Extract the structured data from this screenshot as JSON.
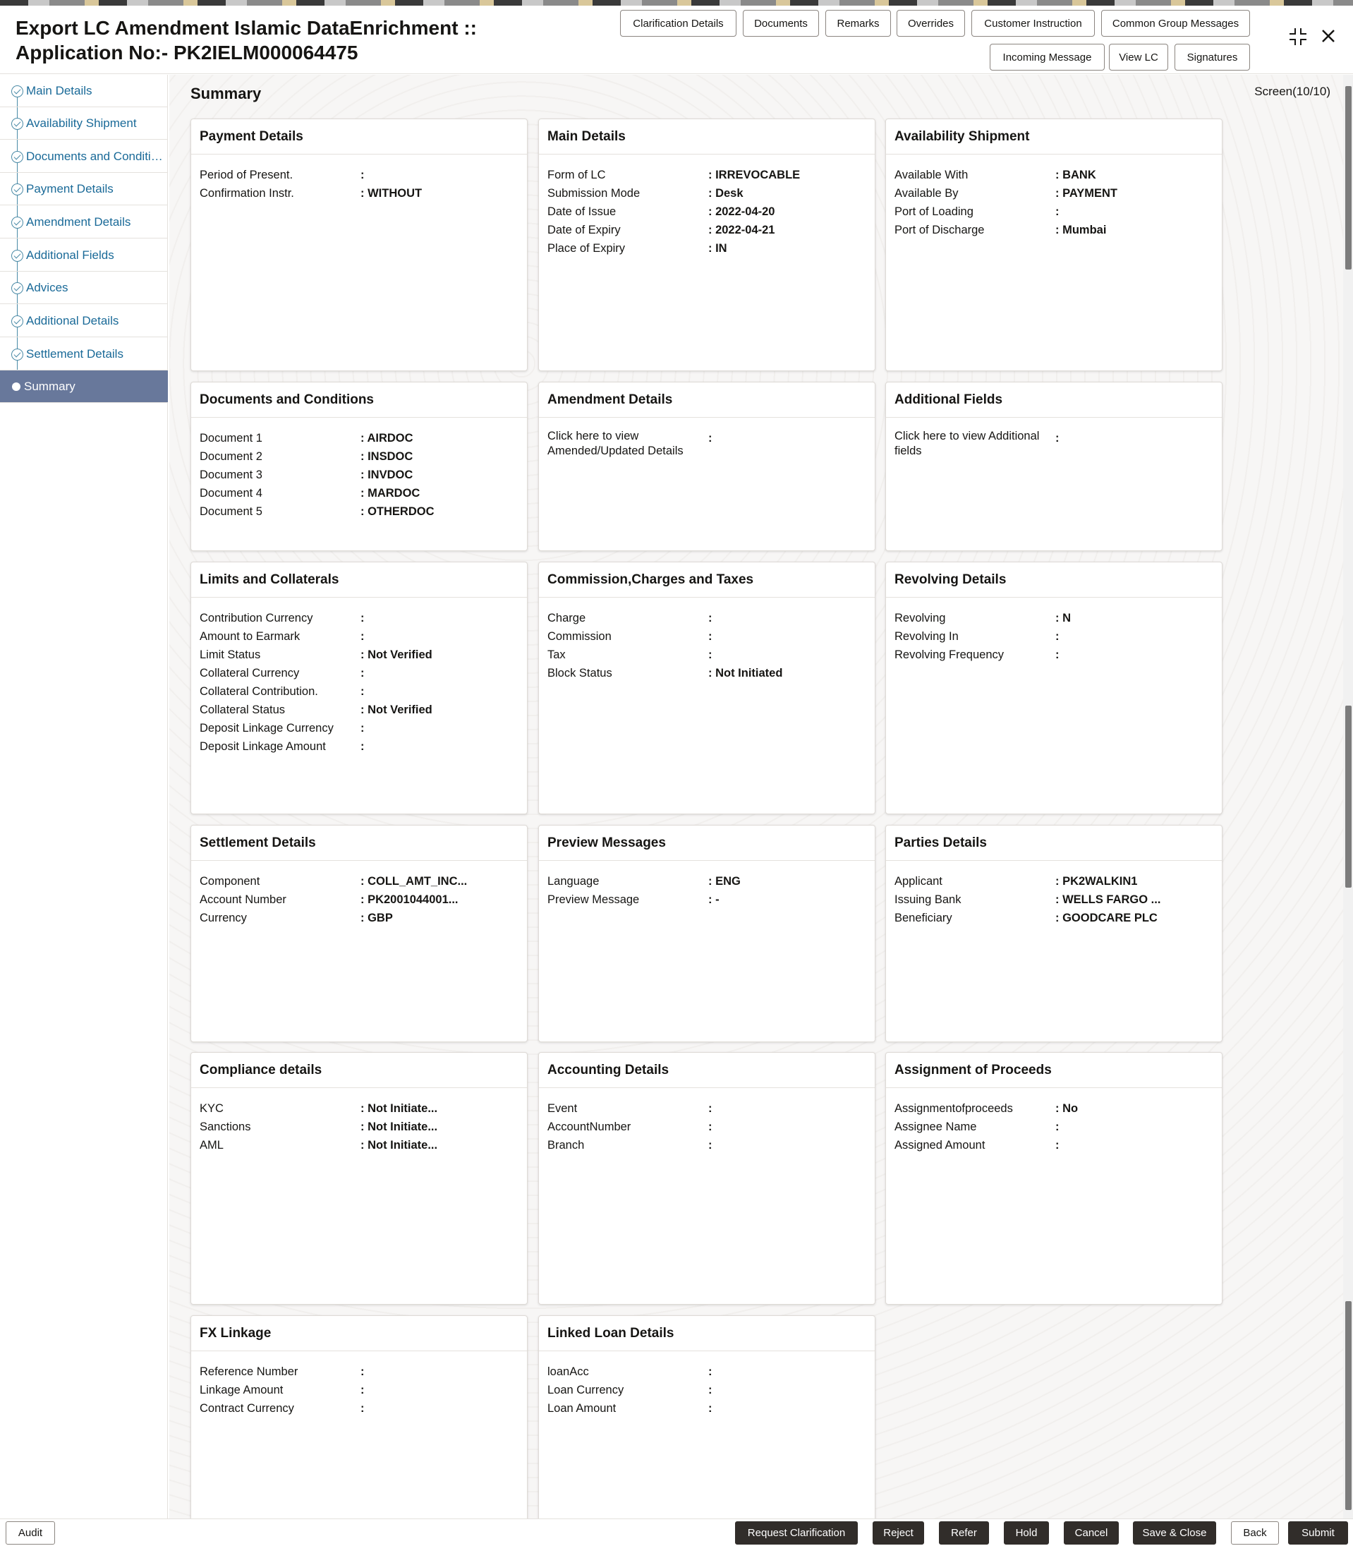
{
  "header": {
    "title": "Export LC Amendment Islamic DataEnrichment :: Application No:- PK2IELM000064475",
    "buttons_row1": [
      "Clarification Details",
      "Documents",
      "Remarks",
      "Overrides",
      "Customer Instruction",
      "Common Group Messages"
    ],
    "buttons_row2": [
      "Incoming Message",
      "View LC",
      "Signatures"
    ],
    "icons": [
      "collapse-icon",
      "close-icon"
    ]
  },
  "sidebar": {
    "items": [
      {
        "label": "Main Details",
        "state": "done"
      },
      {
        "label": "Availability Shipment",
        "state": "done"
      },
      {
        "label": "Documents and Conditions",
        "state": "done"
      },
      {
        "label": "Payment Details",
        "state": "done"
      },
      {
        "label": "Amendment Details",
        "state": "done"
      },
      {
        "label": "Additional Fields",
        "state": "done"
      },
      {
        "label": "Advices",
        "state": "done"
      },
      {
        "label": "Additional Details",
        "state": "done"
      },
      {
        "label": "Settlement Details",
        "state": "done"
      },
      {
        "label": "Summary",
        "state": "active"
      }
    ]
  },
  "main": {
    "title": "Summary",
    "screen_indicator": "Screen(10/10)",
    "cards": [
      {
        "title": "Payment Details",
        "rows": [
          {
            "k": "Period of Present.",
            "v": ":"
          },
          {
            "k": "Confirmation Instr.",
            "v": ": WITHOUT"
          }
        ]
      },
      {
        "title": "Main Details",
        "rows": [
          {
            "k": "Form of LC",
            "v": ": IRREVOCABLE"
          },
          {
            "k": "Submission Mode",
            "v": ": Desk"
          },
          {
            "k": "Date of Issue",
            "v": ": 2022-04-20"
          },
          {
            "k": "Date of Expiry",
            "v": ": 2022-04-21"
          },
          {
            "k": "Place of Expiry",
            "v": ": IN"
          }
        ]
      },
      {
        "title": "Availability Shipment",
        "rows": [
          {
            "k": "Available With",
            "v": ": BANK"
          },
          {
            "k": "Available By",
            "v": ": PAYMENT"
          },
          {
            "k": "Port of Loading",
            "v": ":"
          },
          {
            "k": "Port of Discharge",
            "v": ": Mumbai"
          }
        ]
      },
      {
        "title": "Documents and Conditions",
        "rows": [
          {
            "k": "Document 1",
            "v": ": AIRDOC"
          },
          {
            "k": "Document 2",
            "v": ": INSDOC"
          },
          {
            "k": "Document 3",
            "v": ": INVDOC"
          },
          {
            "k": "Document 4",
            "v": ": MARDOC"
          },
          {
            "k": "Document 5",
            "v": ": OTHERDOC"
          }
        ]
      },
      {
        "title": "Amendment Details",
        "rows": [
          {
            "k": "Click here to view Amended/Updated Details",
            "v": ":"
          }
        ]
      },
      {
        "title": "Additional Fields",
        "rows": [
          {
            "k": "Click here to view Additional fields",
            "v": ":"
          }
        ]
      },
      {
        "title": "Limits and Collaterals",
        "rows": [
          {
            "k": "Contribution Currency",
            "v": ":"
          },
          {
            "k": "Amount to Earmark",
            "v": ":"
          },
          {
            "k": "Limit Status",
            "v": ": Not Verified"
          },
          {
            "k": "Collateral Currency",
            "v": ":"
          },
          {
            "k": "Collateral Contribution.",
            "v": ":"
          },
          {
            "k": "Collateral Status",
            "v": ": Not Verified"
          },
          {
            "k": "Deposit Linkage Currency",
            "v": ":"
          },
          {
            "k": "Deposit Linkage Amount",
            "v": ":"
          }
        ]
      },
      {
        "title": "Commission,Charges and Taxes",
        "rows": [
          {
            "k": "Charge",
            "v": ":"
          },
          {
            "k": "Commission",
            "v": ":"
          },
          {
            "k": "Tax",
            "v": ":"
          },
          {
            "k": "Block Status",
            "v": ": Not Initiated"
          }
        ]
      },
      {
        "title": "Revolving Details",
        "rows": [
          {
            "k": "Revolving",
            "v": ": N"
          },
          {
            "k": "Revolving In",
            "v": ":"
          },
          {
            "k": "Revolving Frequency",
            "v": ":"
          }
        ]
      },
      {
        "title": "Settlement Details",
        "rows": [
          {
            "k": "Component",
            "v": ": COLL_AMT_INC..."
          },
          {
            "k": "Account Number",
            "v": ": PK2001044001..."
          },
          {
            "k": "Currency",
            "v": ": GBP"
          }
        ]
      },
      {
        "title": "Preview Messages",
        "rows": [
          {
            "k": "Language",
            "v": ": ENG"
          },
          {
            "k": "Preview Message",
            "v": ": -"
          }
        ]
      },
      {
        "title": "Parties Details",
        "rows": [
          {
            "k": "Applicant",
            "v": ": PK2WALKIN1"
          },
          {
            "k": "Issuing Bank",
            "v": ": WELLS FARGO ..."
          },
          {
            "k": "Beneficiary",
            "v": ": GOODCARE PLC"
          }
        ]
      },
      {
        "title": "Compliance details",
        "rows": [
          {
            "k": "KYC",
            "v": ": Not Initiate..."
          },
          {
            "k": "Sanctions",
            "v": ": Not Initiate..."
          },
          {
            "k": "AML",
            "v": ": Not Initiate..."
          }
        ]
      },
      {
        "title": "Accounting Details",
        "rows": [
          {
            "k": "Event",
            "v": ":"
          },
          {
            "k": "AccountNumber",
            "v": ":"
          },
          {
            "k": "Branch",
            "v": ":"
          }
        ]
      },
      {
        "title": "Assignment of Proceeds",
        "rows": [
          {
            "k": "Assignmentofproceeds",
            "v": ": No"
          },
          {
            "k": "Assignee Name",
            "v": ":"
          },
          {
            "k": "Assigned Amount",
            "v": ":"
          }
        ]
      },
      {
        "title": "FX Linkage",
        "rows": [
          {
            "k": "Reference Number",
            "v": ":"
          },
          {
            "k": "Linkage Amount",
            "v": ":"
          },
          {
            "k": "Contract Currency",
            "v": ":"
          }
        ]
      },
      {
        "title": "Linked Loan Details",
        "rows": [
          {
            "k": "loanAcc",
            "v": ":"
          },
          {
            "k": "Loan Currency",
            "v": ":"
          },
          {
            "k": "Loan Amount",
            "v": ":"
          }
        ]
      }
    ]
  },
  "footer": {
    "audit": "Audit",
    "actions": [
      "Request Clarification",
      "Reject",
      "Refer",
      "Hold",
      "Cancel",
      "Save & Close",
      "Back",
      "Submit"
    ]
  },
  "colors": {
    "active_nav": "#68789b",
    "nav_link": "#1a6a98",
    "dark_button": "#312d2a"
  }
}
